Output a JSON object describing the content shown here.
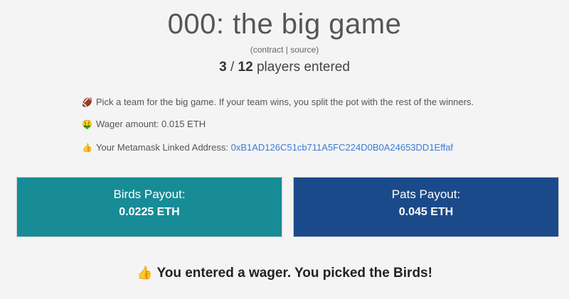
{
  "header": {
    "title": "000: the big game",
    "contract_link": "contract",
    "separator": "|",
    "source_link": "source",
    "paren_open": "(",
    "paren_close": ")"
  },
  "players": {
    "entered": "3",
    "divider": "/",
    "total": "12",
    "suffix": "players entered"
  },
  "info": {
    "pick_icon": "🏈",
    "pick_text": "Pick a team for the big game. If your team wins, you split the pot with the rest of the winners.",
    "wager_icon": "🤑",
    "wager_text": "Wager amount: 0.015 ETH",
    "address_icon": "👍",
    "address_label": "Your Metamask Linked Address:",
    "address_value": "0xB1AD126C51cb711A5FC224D0B0A24653DD1Effaf"
  },
  "cards": {
    "birds": {
      "label": "Birds Payout:",
      "amount": "0.0225 ETH",
      "color": "#178c96"
    },
    "pats": {
      "label": "Pats Payout:",
      "amount": "0.045 ETH",
      "color": "#1b4a8a"
    }
  },
  "result": {
    "icon": "👍",
    "text": "You entered a wager. You picked the Birds!"
  }
}
